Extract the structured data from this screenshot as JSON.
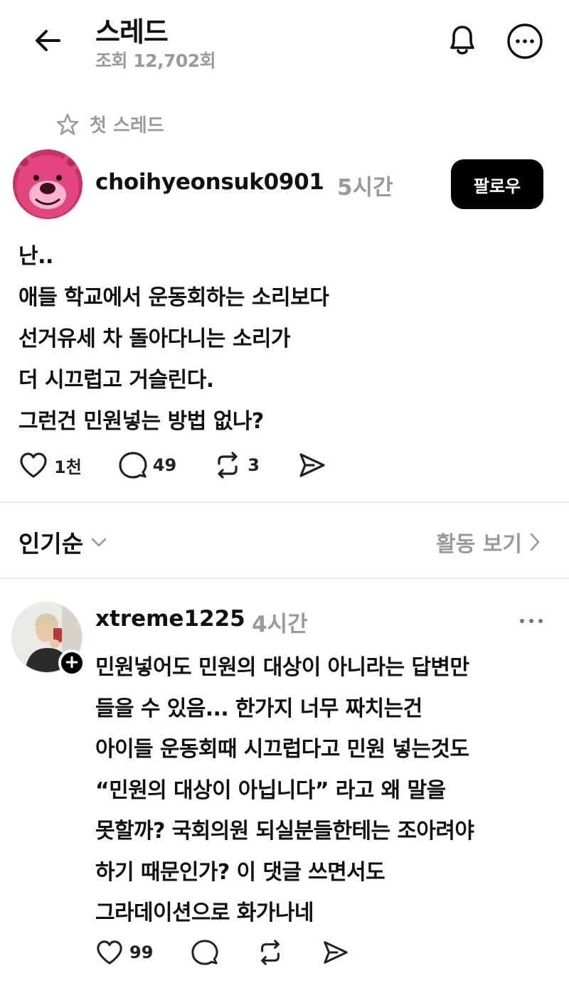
{
  "header": {
    "title": "스레드",
    "views": "조회 12,702회"
  },
  "first_thread_label": "첫 스레드",
  "post": {
    "username": "choihyeonsuk0901",
    "time": "5시간",
    "follow_label": "팔로우",
    "lines": [
      "난..",
      "애들 학교에서 운동회하는 소리보다",
      "선거유세 차 돌아다니는 소리가",
      "더 시끄럽고 거슬린다.",
      "그런건 민원넣는 방법 없나?"
    ],
    "likes": "1천",
    "comments": "49",
    "reposts": "3"
  },
  "sort": {
    "label": "인기순",
    "activity_label": "활동 보기"
  },
  "reply": {
    "username": "xtreme1225",
    "time": "4시간",
    "lines": [
      "민원넣어도 민원의 대상이 아니라는 답변만",
      "들을 수 있음... 한가지 너무 짜치는건",
      "아이들 운동회때 시끄럽다고 민원 넣는것도",
      "“민원의 대상이 아닙니다”  라고 왜 말을",
      "못할까? 국회의원 되실분들한테는 조아려야",
      "하기 때문인가? 이 댓글 쓰면서도",
      "그라데이션으로 화가나네"
    ],
    "likes": "99"
  },
  "colors": {
    "muted": "#9a9a9a",
    "follow_bg": "#000000",
    "avatar1_pink": "#e3467f"
  },
  "icons": {
    "back": "arrow-left-icon",
    "bell": "bell-icon",
    "more": "more-horizontal-circle-icon",
    "star": "star-outline-icon",
    "like": "heart-icon",
    "comment": "comment-bubble-icon",
    "repost": "repost-icon",
    "share": "send-icon"
  }
}
